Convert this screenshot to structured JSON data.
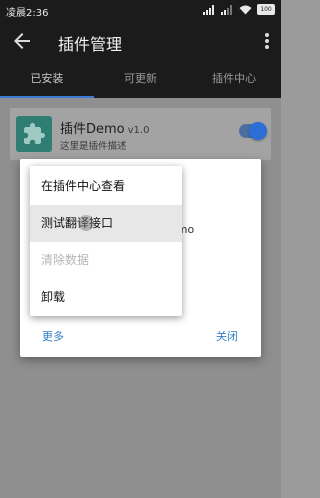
{
  "status_bar": {
    "time": "凌晨2:36",
    "battery": "100"
  },
  "toolbar": {
    "title": "插件管理",
    "back_icon": "arrow-left-icon",
    "more_icon": "more-vertical-icon"
  },
  "tabs": [
    {
      "label": "已安装",
      "active": true
    },
    {
      "label": "可更新",
      "active": false
    },
    {
      "label": "插件中心",
      "active": false
    }
  ],
  "plugin": {
    "name": "插件Demo",
    "version": "v1.0",
    "description": "这里是插件描述",
    "enabled": true,
    "icon": "puzzle-piece-icon"
  },
  "dialog": {
    "partial_text": "emo",
    "more_label": "更多",
    "close_label": "关闭"
  },
  "menu": {
    "items": [
      {
        "label": "在插件中心查看",
        "enabled": true
      },
      {
        "label": "测试翻译接口",
        "enabled": true,
        "pressed": true
      },
      {
        "label": "清除数据",
        "enabled": false
      },
      {
        "label": "卸载",
        "enabled": true
      }
    ]
  },
  "colors": {
    "accent": "#2f7ec4",
    "toolbar": "#1b1b1b",
    "plugin_icon": "#2f7d73"
  }
}
